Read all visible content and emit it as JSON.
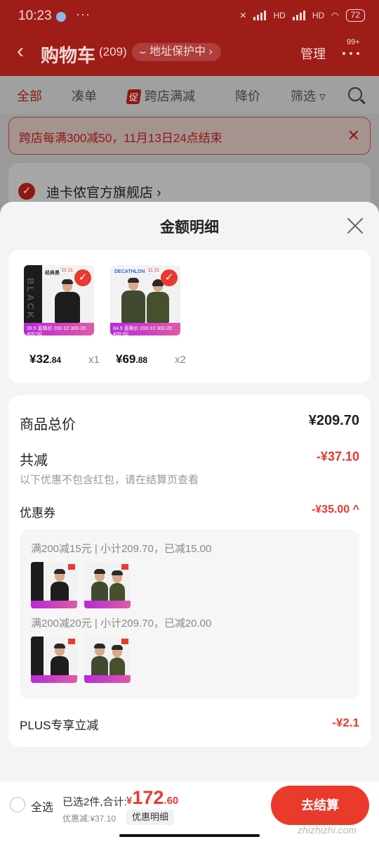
{
  "status_bar": {
    "time": "10:23",
    "more": "···",
    "network_1": "HD",
    "network_2": "HD",
    "battery": "72"
  },
  "header": {
    "title": "购物车",
    "count": "(209)",
    "address_protection": "地址保护中",
    "manage": "管理",
    "more_badge": "99+"
  },
  "tabs": [
    {
      "label": "全部"
    },
    {
      "label": "凑单"
    },
    {
      "label": "跨店满减",
      "tag": "促"
    },
    {
      "label": "降价"
    },
    {
      "label": "筛选"
    }
  ],
  "promo_banner": {
    "text": "跨店每满300减50，11月13日24点结束"
  },
  "store": {
    "name": "迪卡侬官方旗舰店 ›"
  },
  "sheet": {
    "title": "金额明细",
    "products": [
      {
        "price_int": "¥32",
        "price_dec": ".84",
        "qty": "x1",
        "brand": "经典黑",
        "side_word": "BLACK",
        "strip_text": "39.9 直降价 200-10 300-20 400-50",
        "corner_tag": "11.11"
      },
      {
        "price_int": "¥69",
        "price_dec": ".88",
        "qty": "x2",
        "brand": "DECATHLON",
        "strip_text": "84.9 直降价 200-10 300-20 400-50",
        "corner_tag": "11.11"
      }
    ],
    "summary": {
      "total_label": "商品总价",
      "total_value": "¥209.70",
      "reduce_label": "共减",
      "reduce_value": "-¥37.10",
      "note": "以下优惠不包含红包，请在结算页查看",
      "coupon_label": "优惠券",
      "coupon_value": "-¥35.00 ^",
      "coupon_lines": [
        "满200减15元 | 小计209.70，已减15.00",
        "满200减20元 | 小计209.70，已减20.00"
      ],
      "plus_label": "PLUS专享立减",
      "plus_value": "-¥2.1"
    }
  },
  "bottom_bar": {
    "select_all": "全选",
    "selected_text": "已选2件,合计:",
    "total_yen": "¥",
    "total_int": "172",
    "total_dec": ".60",
    "discount": "优惠减:¥37.10",
    "detail": "优惠明细",
    "checkout": "去结算",
    "watermark": "zhizhizhi.com"
  },
  "colors": {
    "accent": "#e83a2f",
    "header_dim": "#9e1d19",
    "sheet_bg": "#f4f4f4"
  },
  "icons": [
    "back-icon",
    "shield-icon",
    "more-icon",
    "filter-icon",
    "search-icon",
    "close-icon",
    "check-icon"
  ]
}
